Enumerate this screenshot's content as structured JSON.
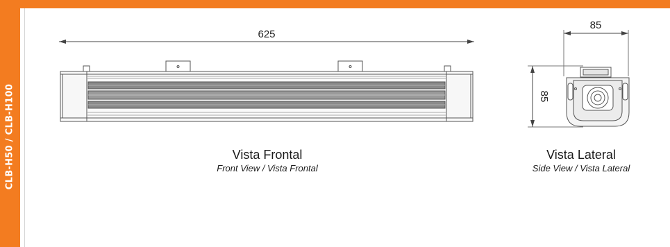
{
  "side_tab": {
    "label": "CLB-H50 / CLB-H100"
  },
  "front_view": {
    "dimension": "625",
    "title": "Vista Frontal",
    "subtitle": "Front View / Vista Frontal"
  },
  "side_view": {
    "width_dimension": "85",
    "height_dimension": "85",
    "title": "Vista Lateral",
    "subtitle": "Side View / Vista Lateral"
  },
  "colors": {
    "accent": "#f37c20",
    "line": "#555555"
  }
}
